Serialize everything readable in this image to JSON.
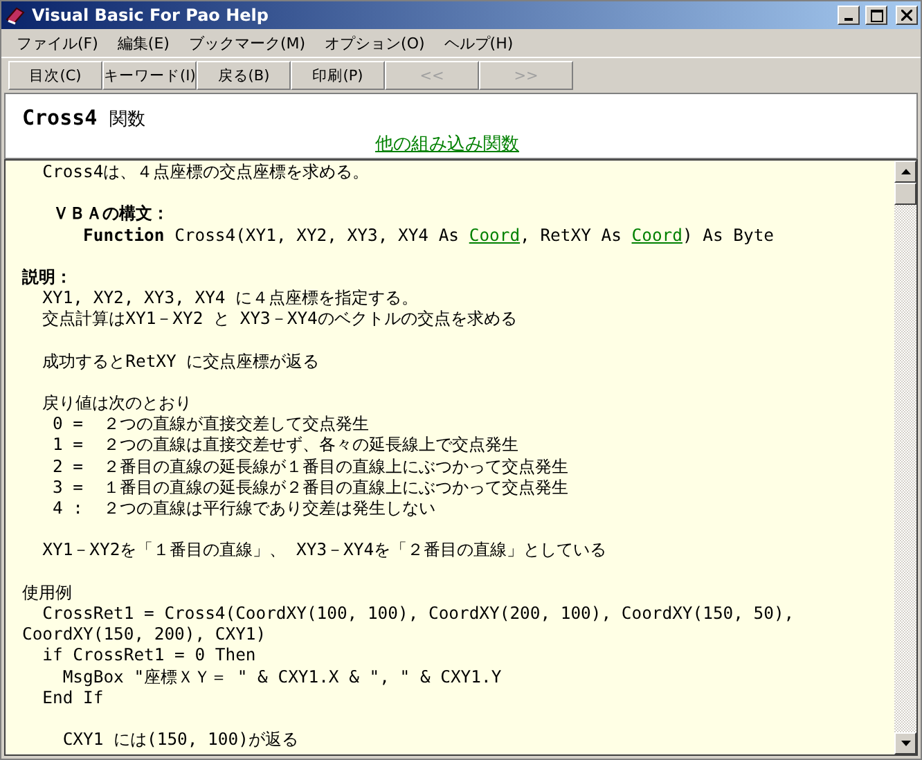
{
  "window": {
    "title": "Visual Basic For Pao Help"
  },
  "menu": [
    "ファイル(F)",
    "編集(E)",
    "ブックマーク(M)",
    "オプション(O)",
    "ヘルプ(H)"
  ],
  "toolbar": [
    {
      "label": "目次(C)",
      "disabled": false
    },
    {
      "label": "キーワード(I)",
      "disabled": false
    },
    {
      "label": "戻る(B)",
      "disabled": false
    },
    {
      "label": "印刷(P)",
      "disabled": false
    },
    {
      "label": "<<",
      "disabled": true
    },
    {
      "label": ">>",
      "disabled": true
    }
  ],
  "header": {
    "title": "Cross4",
    "subtitle": "関数",
    "link": "他の組み込み関数"
  },
  "lines": [
    {
      "kind": "text",
      "parts": [
        {
          "kind": "plain",
          "text": "  Cross4は、４点座標の交点座標を求める。"
        }
      ]
    },
    {
      "kind": "blank"
    },
    {
      "kind": "text",
      "parts": [
        {
          "kind": "bold",
          "text": "   ＶＢＡの構文："
        }
      ]
    },
    {
      "kind": "text",
      "parts": [
        {
          "kind": "bold",
          "text": "      Function"
        },
        {
          "kind": "plain",
          "text": " Cross4(XY1, XY2, XY3, XY4 As "
        },
        {
          "kind": "link",
          "text": "Coord"
        },
        {
          "kind": "plain",
          "text": ", RetXY As "
        },
        {
          "kind": "link",
          "text": "Coord"
        },
        {
          "kind": "plain",
          "text": ") As Byte"
        }
      ]
    },
    {
      "kind": "blank"
    },
    {
      "kind": "text",
      "parts": [
        {
          "kind": "bold",
          "text": "説明："
        }
      ]
    },
    {
      "kind": "text",
      "parts": [
        {
          "kind": "plain",
          "text": "  XY1, XY2, XY3, XY4 に４点座標を指定する。"
        }
      ]
    },
    {
      "kind": "text",
      "parts": [
        {
          "kind": "plain",
          "text": "  交点計算はXY1－XY2 と XY3－XY4のベクトルの交点を求める"
        }
      ]
    },
    {
      "kind": "blank"
    },
    {
      "kind": "text",
      "parts": [
        {
          "kind": "plain",
          "text": "  成功するとRetXY に交点座標が返る"
        }
      ]
    },
    {
      "kind": "blank"
    },
    {
      "kind": "text",
      "parts": [
        {
          "kind": "plain",
          "text": "  戻り値は次のとおり"
        }
      ]
    },
    {
      "kind": "text",
      "parts": [
        {
          "kind": "plain",
          "text": "   0 =  ２つの直線が直接交差して交点発生"
        }
      ]
    },
    {
      "kind": "text",
      "parts": [
        {
          "kind": "plain",
          "text": "   1 =  ２つの直線は直接交差せず、各々の延長線上で交点発生"
        }
      ]
    },
    {
      "kind": "text",
      "parts": [
        {
          "kind": "plain",
          "text": "   2 =  ２番目の直線の延長線が１番目の直線上にぶつかって交点発生"
        }
      ]
    },
    {
      "kind": "text",
      "parts": [
        {
          "kind": "plain",
          "text": "   3 =  １番目の直線の延長線が２番目の直線上にぶつかって交点発生"
        }
      ]
    },
    {
      "kind": "text",
      "parts": [
        {
          "kind": "plain",
          "text": "   4 :  ２つの直線は平行線であり交差は発生しない"
        }
      ]
    },
    {
      "kind": "blank"
    },
    {
      "kind": "text",
      "parts": [
        {
          "kind": "plain",
          "text": "  XY1－XY2を「１番目の直線」、 XY3－XY4を「２番目の直線」としている"
        }
      ]
    },
    {
      "kind": "blank"
    },
    {
      "kind": "text",
      "parts": [
        {
          "kind": "plain",
          "text": "使用例"
        }
      ]
    },
    {
      "kind": "text",
      "parts": [
        {
          "kind": "plain",
          "text": "  CrossRet1 = Cross4(CoordXY(100, 100), CoordXY(200, 100), CoordXY(150, 50),"
        }
      ]
    },
    {
      "kind": "text",
      "parts": [
        {
          "kind": "plain",
          "text": "CoordXY(150, 200), CXY1)"
        }
      ]
    },
    {
      "kind": "text",
      "parts": [
        {
          "kind": "plain",
          "text": "  if CrossRet1 = 0 Then"
        }
      ]
    },
    {
      "kind": "text",
      "parts": [
        {
          "kind": "plain",
          "text": "    MsgBox \"座標ＸＹ＝ \" & CXY1.X & \", \" & CXY1.Y"
        }
      ]
    },
    {
      "kind": "text",
      "parts": [
        {
          "kind": "plain",
          "text": "  End If"
        }
      ]
    },
    {
      "kind": "blank"
    },
    {
      "kind": "text",
      "parts": [
        {
          "kind": "plain",
          "text": "    CXY1 には(150, 100)が返る"
        }
      ]
    }
  ]
}
